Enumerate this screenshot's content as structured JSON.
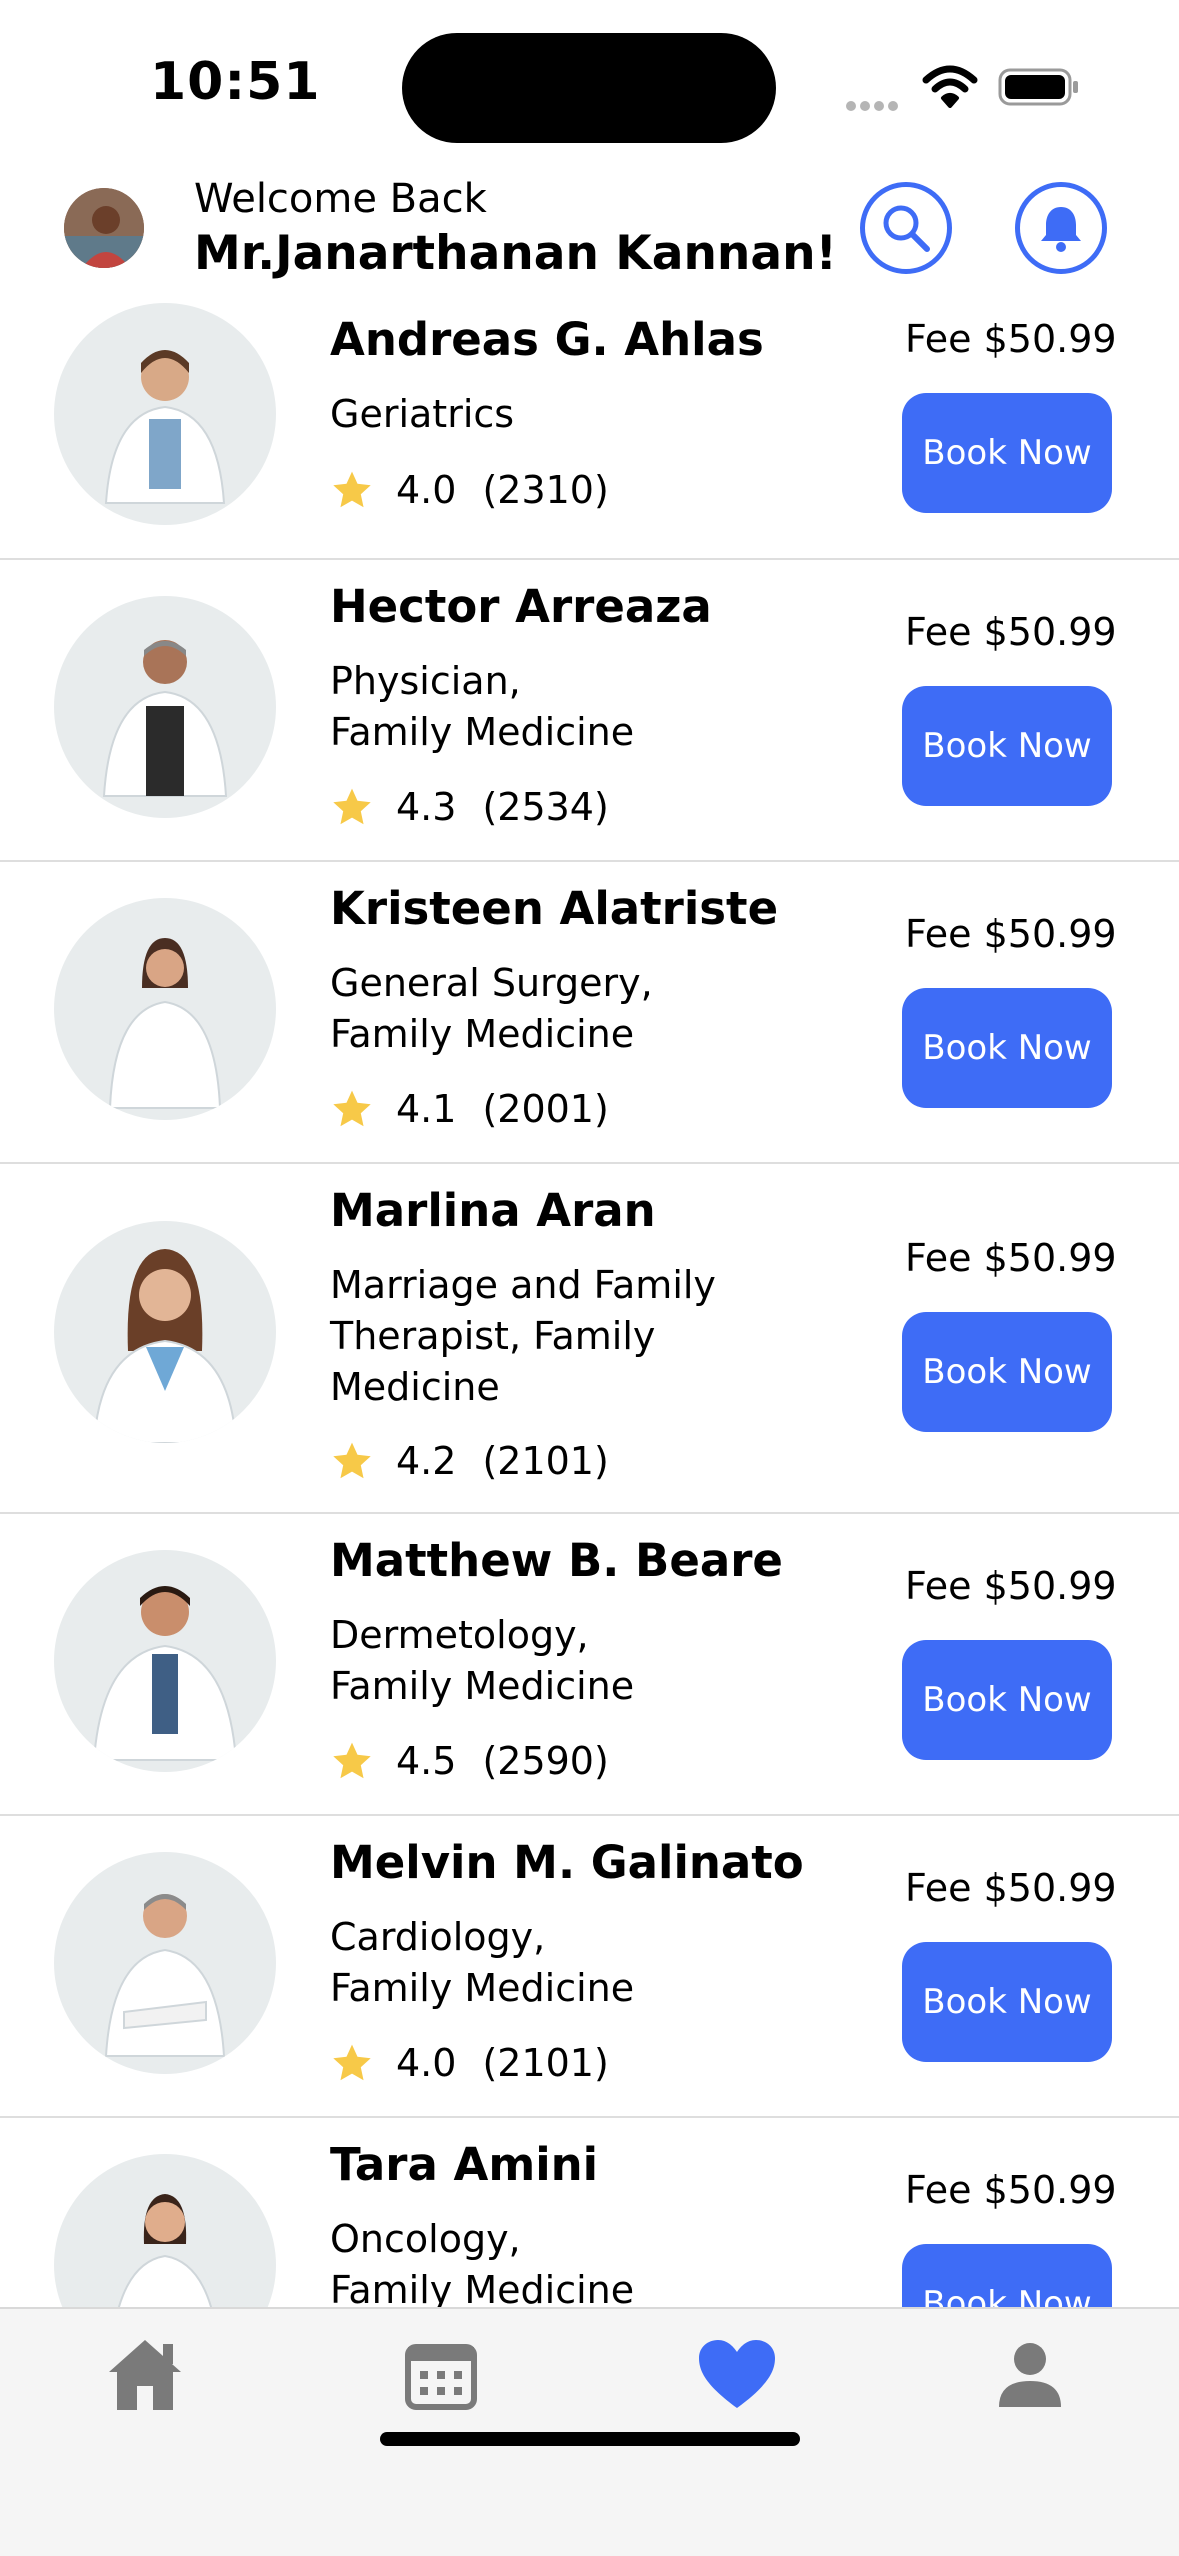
{
  "status_bar": {
    "time": "10:51"
  },
  "header": {
    "welcome": "Welcome Back",
    "user_name": "Mr.Janarthanan Kannan!",
    "icons": {
      "search": "search-icon",
      "notifications": "bell-icon"
    }
  },
  "colors": {
    "accent": "#3e6cf6",
    "star": "#f7c948",
    "photo_bg": "#e8eced",
    "tab_inactive": "#7a7a7a"
  },
  "doctors": [
    {
      "name": "Andreas G. Ahlas",
      "specialty": "Geriatrics",
      "rating": "4.0",
      "reviews": "(2310)",
      "fee": "Fee $50.99",
      "button": "Book Now"
    },
    {
      "name": "Hector Arreaza",
      "specialty": "Physician,\nFamily Medicine",
      "rating": "4.3",
      "reviews": "(2534)",
      "fee": "Fee $50.99",
      "button": "Book Now"
    },
    {
      "name": "Kristeen Alatriste",
      "specialty": "General Surgery,\nFamily Medicine",
      "rating": "4.1",
      "reviews": "(2001)",
      "fee": "Fee $50.99",
      "button": "Book Now"
    },
    {
      "name": "Marlina Aran",
      "specialty": "Marriage and Family Therapist, Family Medicine",
      "rating": "4.2",
      "reviews": "(2101)",
      "fee": "Fee $50.99",
      "button": "Book Now"
    },
    {
      "name": "Matthew B. Beare",
      "specialty": "Dermetology,\nFamily Medicine",
      "rating": "4.5",
      "reviews": "(2590)",
      "fee": "Fee $50.99",
      "button": "Book Now"
    },
    {
      "name": "Melvin M. Galinato",
      "specialty": "Cardiology,\nFamily Medicine",
      "rating": "4.0",
      "reviews": "(2101)",
      "fee": "Fee $50.99",
      "button": "Book Now"
    },
    {
      "name": "Tara Amini",
      "specialty": "Oncology,\nFamily Medicine",
      "rating": "",
      "reviews": "",
      "fee": "Fee $50.99",
      "button": "Book Now"
    }
  ],
  "tab_bar": {
    "tabs": [
      {
        "icon": "home-icon",
        "active": false
      },
      {
        "icon": "calendar-icon",
        "active": false
      },
      {
        "icon": "heart-icon",
        "active": true
      },
      {
        "icon": "person-icon",
        "active": false
      }
    ]
  }
}
